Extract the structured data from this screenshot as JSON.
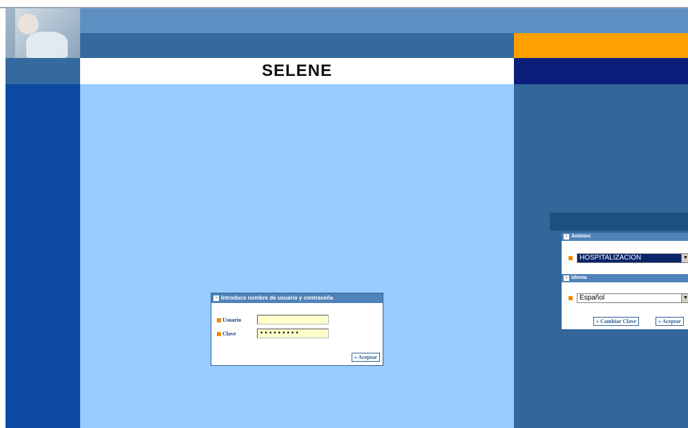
{
  "header": {
    "app_title": "SELENE"
  },
  "login": {
    "heading": "Introduce nombre de usuario y contraseña",
    "user_label": "Usuario",
    "user_value": "",
    "password_label": "Clave",
    "password_value": "•••••••••",
    "accept_button": "Aceptar"
  },
  "settings": {
    "ambitos_heading": "Ámbitos",
    "ambito_selected": "HOSPITALIZACIÓN",
    "idioma_heading": "Idioma",
    "idioma_selected": "Español",
    "change_password_button": "Cambiar Clave",
    "accept_button": "Aceptar"
  },
  "icons": {
    "head_arrow": "arrow-right-icon",
    "bullet": "orange-bullet-icon",
    "dropdown": "chevron-down-icon",
    "button_arrows": "double-chevron-right-icon"
  },
  "colors": {
    "accent_orange": "#ff9f00",
    "navy": "#0b1f7a",
    "panel_head": "#4f82b8",
    "center_bg": "#99ccff",
    "left_column": "#0d4aa2",
    "right_column": "#336699"
  }
}
